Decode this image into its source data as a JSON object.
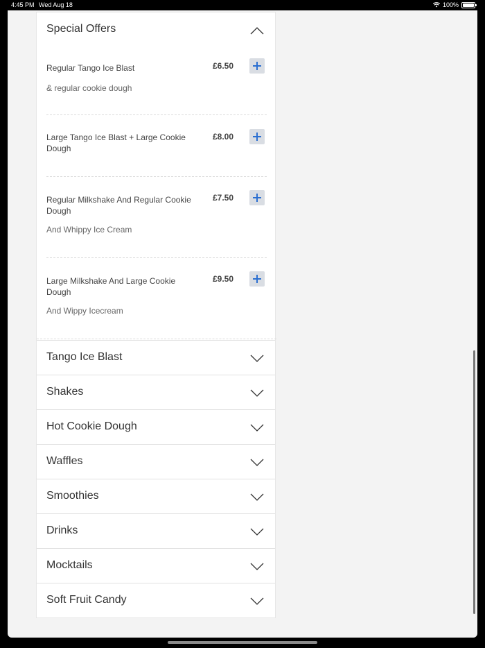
{
  "status": {
    "time": "4:45 PM",
    "date": "Wed Aug 18",
    "battery": "100%",
    "battery_level": 1.0
  },
  "special_offers": {
    "title": "Special Offers",
    "items": [
      {
        "name": "Regular Tango Ice Blast",
        "price": "£6.50",
        "description": "& regular cookie dough"
      },
      {
        "name": "Large Tango Ice Blast + Large Cookie Dough",
        "price": "£8.00",
        "description": ""
      },
      {
        "name": "Regular Milkshake And Regular Cookie Dough",
        "price": "£7.50",
        "description": "And Whippy Ice Cream"
      },
      {
        "name": "Large Milkshake And Large Cookie Dough",
        "price": "£9.50",
        "description": "And Wippy Icecream"
      }
    ]
  },
  "categories": [
    {
      "label": "Tango Ice Blast"
    },
    {
      "label": "Shakes"
    },
    {
      "label": "Hot Cookie Dough"
    },
    {
      "label": "Waffles"
    },
    {
      "label": "Smoothies"
    },
    {
      "label": "Drinks"
    },
    {
      "label": "Mocktails"
    },
    {
      "label": "Soft Fruit Candy"
    }
  ],
  "colors": {
    "accent": "#2b6fd1",
    "add_button_bg": "#d9dde3"
  },
  "icons": {
    "collapse": "chevron-up-icon",
    "expand": "chevron-down-icon",
    "add": "plus-icon"
  }
}
